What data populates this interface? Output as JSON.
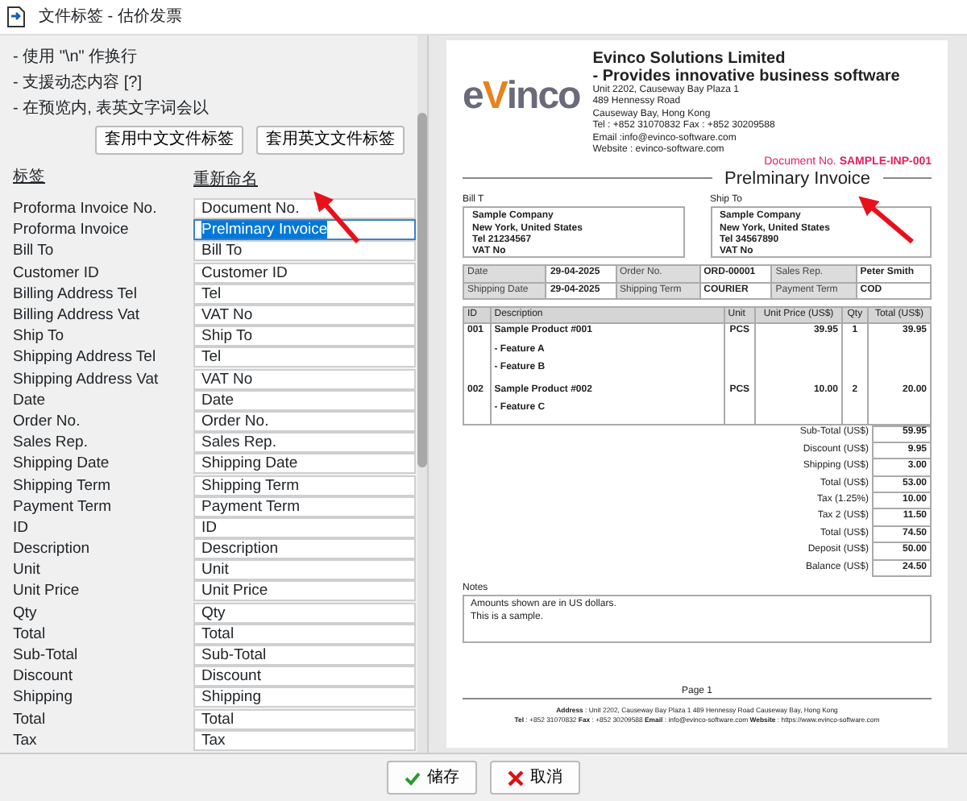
{
  "window": {
    "title": "文件标签 - 估价发票"
  },
  "instructions": [
    {
      "text": "- 使用 \"\\n\" 作换行"
    },
    {
      "text": "- 支援动态内容 [?]"
    },
    {
      "text": "- 在预览内, 表英文字词会以"
    }
  ],
  "preset_buttons": [
    "套用中文文件标签",
    "套用英文文件标签"
  ],
  "table": {
    "columns": [
      "标签",
      "重新命名"
    ],
    "rows": [
      {
        "label": "Proforma Invoice No.",
        "value": "Document No.",
        "selected": false
      },
      {
        "label": "Proforma Invoice",
        "value": "Prelminary Invoice",
        "selected": true
      },
      {
        "label": "Bill To",
        "value": "Bill To",
        "selected": false
      },
      {
        "label": "Customer ID",
        "value": "Customer ID",
        "selected": false
      },
      {
        "label": "Billing Address Tel",
        "value": "Tel",
        "selected": false
      },
      {
        "label": "Billing Address Vat",
        "value": "VAT No",
        "selected": false
      },
      {
        "label": "Ship To",
        "value": "Ship To",
        "selected": false
      },
      {
        "label": "Shipping Address Tel",
        "value": "Tel",
        "selected": false
      },
      {
        "label": "Shipping Address Vat",
        "value": "VAT No",
        "selected": false
      },
      {
        "label": "Date",
        "value": "Date",
        "selected": false
      },
      {
        "label": "Order No.",
        "value": "Order No.",
        "selected": false
      },
      {
        "label": "Sales Rep.",
        "value": "Sales Rep.",
        "selected": false
      },
      {
        "label": "Shipping Date",
        "value": "Shipping Date",
        "selected": false
      },
      {
        "label": "Shipping Term",
        "value": "Shipping Term",
        "selected": false
      },
      {
        "label": "Payment Term",
        "value": "Payment Term",
        "selected": false
      },
      {
        "label": "ID",
        "value": "ID",
        "selected": false
      },
      {
        "label": "Description",
        "value": "Description",
        "selected": false
      },
      {
        "label": "Unit",
        "value": "Unit",
        "selected": false
      },
      {
        "label": "Unit Price",
        "value": "Unit Price",
        "selected": false
      },
      {
        "label": "Qty",
        "value": "Qty",
        "selected": false
      },
      {
        "label": "Total",
        "value": "Total",
        "selected": false
      },
      {
        "label": "Sub-Total",
        "value": "Sub-Total",
        "selected": false
      },
      {
        "label": "Discount",
        "value": "Discount",
        "selected": false
      },
      {
        "label": "Shipping",
        "value": "Shipping",
        "selected": false
      },
      {
        "label": "Total",
        "value": "Total",
        "selected": false
      },
      {
        "label": "Tax",
        "value": "Tax",
        "selected": false
      }
    ]
  },
  "preview": {
    "logo": "eVinco",
    "company": {
      "name": "Evinco Solutions Limited",
      "tagline": "- Provides innovative business software",
      "lines": [
        "Unit 2202, Causeway Bay Plaza 1",
        "489 Hennessy Road",
        "Causeway Bay, Hong Kong",
        "Tel : +852 31070832      Fax : +852 30209588",
        "Email :info@evinco-software.com",
        "Website : evinco-software.com"
      ]
    },
    "document_no": {
      "label": "Document No.",
      "value": "SAMPLE-INP-001"
    },
    "title": "Prelminary Invoice",
    "bill_to": {
      "label": "Bill T",
      "lines": [
        "Sample Company",
        "New York, United States",
        "Tel 21234567",
        "VAT No"
      ]
    },
    "ship_to": {
      "label": "Ship To",
      "lines": [
        "Sample Company",
        "New York, United States",
        "Tel 34567890",
        "VAT No"
      ]
    },
    "info": [
      [
        "Date",
        "29-04-2025",
        "Order No.",
        "ORD-00001",
        "Sales Rep.",
        "Peter Smith"
      ],
      [
        "Shipping Date",
        "29-04-2025",
        "Shipping Term",
        "COURIER",
        "Payment Term",
        "COD"
      ]
    ],
    "items": {
      "columns": [
        "ID",
        "Description",
        "Unit",
        "Unit Price (US$)",
        "Qty",
        "Total (US$)"
      ],
      "rows": [
        {
          "id": "001",
          "lines": [
            "Sample Product #001",
            "- Feature A",
            "- Feature B"
          ],
          "unit": "PCS",
          "price": "39.95",
          "qty": "1",
          "total": "39.95"
        },
        {
          "id": "002",
          "lines": [
            "Sample Product #002",
            "- Feature C"
          ],
          "unit": "PCS",
          "price": "10.00",
          "qty": "2",
          "total": "20.00"
        }
      ]
    },
    "totals": [
      {
        "label": "Sub-Total (US$)",
        "value": "59.95"
      },
      {
        "label": "Discount (US$)",
        "value": "9.95"
      },
      {
        "label": "Shipping (US$)",
        "value": "3.00"
      },
      {
        "label": "Total (US$)",
        "value": "53.00"
      },
      {
        "label": "Tax (1.25%)",
        "value": "10.00"
      },
      {
        "label": "Tax 2 (US$)",
        "value": "11.50"
      },
      {
        "label": "Total (US$)",
        "value": "74.50"
      },
      {
        "label": "Deposit (US$)",
        "value": "50.00"
      },
      {
        "label": "Balance (US$)",
        "value": "24.50"
      }
    ],
    "notes": {
      "label": "Notes",
      "lines": [
        "Amounts shown are in US dollars.",
        "This is a sample."
      ]
    },
    "footer": {
      "page": "Page 1",
      "lines": [
        "**Address** : Unit 2202, Causeway Bay Plaza 1 489 Hennessy Road Causeway Bay, Hong Kong",
        "**Tel** : +852 31070832   **Fax** : +852 30209588   **Email** : info@evinco-software.com   **Website** : https://www.evinco-software.com"
      ]
    }
  },
  "buttons": [
    {
      "label": "储存",
      "kind": "save"
    },
    {
      "label": "取消",
      "kind": "cancel"
    }
  ]
}
